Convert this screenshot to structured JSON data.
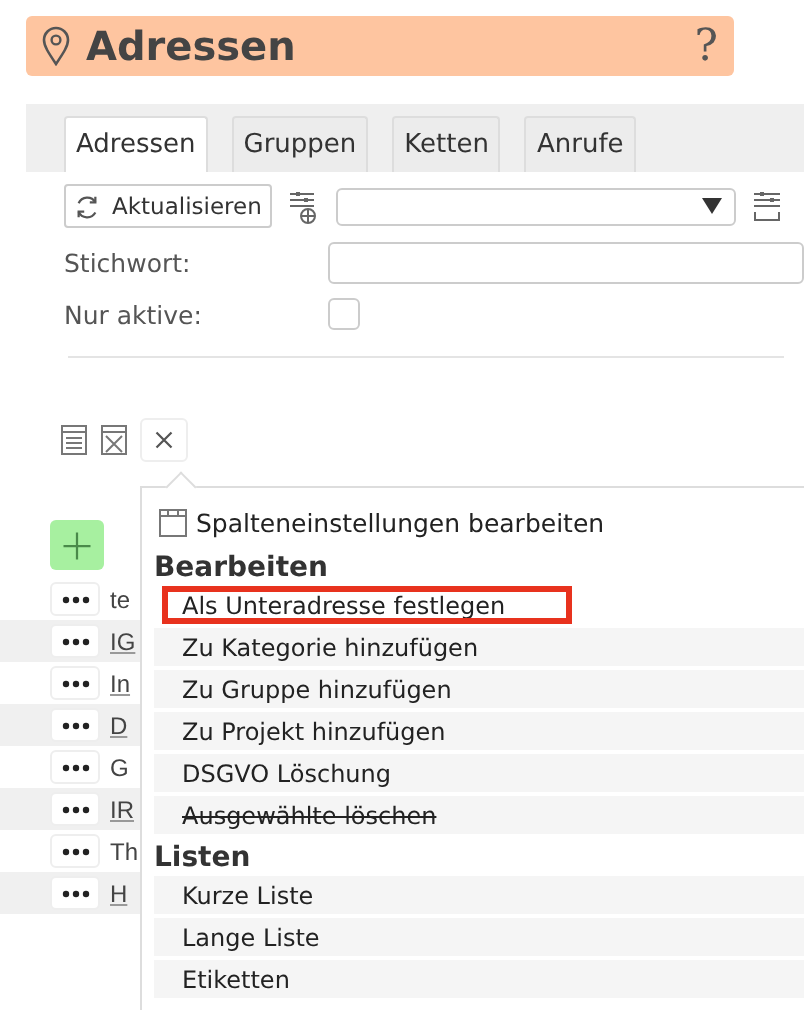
{
  "header": {
    "title": "Adressen",
    "help": "?"
  },
  "tabs": [
    {
      "label": "Adressen",
      "selected": true
    },
    {
      "label": "Gruppen",
      "selected": false
    },
    {
      "label": "Ketten",
      "selected": false
    },
    {
      "label": "Anrufe",
      "selected": false
    }
  ],
  "toolbar": {
    "refresh": "Aktualisieren"
  },
  "filters": [
    {
      "label": "Stichwort:",
      "kind": "text"
    },
    {
      "label": "Nur aktive:",
      "kind": "checkbox",
      "checked": false
    }
  ],
  "rows": [
    {
      "text": "te",
      "link": false
    },
    {
      "text": "IG",
      "link": true
    },
    {
      "text": "In",
      "link": true
    },
    {
      "text": "D",
      "link": true
    },
    {
      "text": "G",
      "link": false
    },
    {
      "text": "IR",
      "link": true
    },
    {
      "text": "Th",
      "link": false
    },
    {
      "text": "H",
      "link": true
    }
  ],
  "menu": [
    {
      "kind": "item",
      "label": "Spalteneinstellungen bearbeiten",
      "icon": true,
      "selected": false,
      "disabled": false
    },
    {
      "kind": "header",
      "label": "Bearbeiten"
    },
    {
      "kind": "item",
      "label": "Als Unteradresse festlegen",
      "icon": false,
      "selected": true,
      "disabled": false
    },
    {
      "kind": "item",
      "label": "Zu Kategorie hinzufügen",
      "icon": false,
      "selected": false,
      "disabled": false
    },
    {
      "kind": "item",
      "label": "Zu Gruppe hinzufügen",
      "icon": false,
      "selected": false,
      "disabled": false
    },
    {
      "kind": "item",
      "label": "Zu Projekt hinzufügen",
      "icon": false,
      "selected": false,
      "disabled": false
    },
    {
      "kind": "item",
      "label": "DSGVO Löschung",
      "icon": false,
      "selected": false,
      "disabled": false
    },
    {
      "kind": "item",
      "label": "Ausgewählte löschen",
      "icon": false,
      "selected": false,
      "disabled": true
    },
    {
      "kind": "header",
      "label": "Listen"
    },
    {
      "kind": "item",
      "label": "Kurze Liste",
      "icon": false,
      "selected": false,
      "disabled": false
    },
    {
      "kind": "item",
      "label": "Lange Liste",
      "icon": false,
      "selected": false,
      "disabled": false
    },
    {
      "kind": "item",
      "label": "Etiketten",
      "icon": false,
      "selected": false,
      "disabled": false
    }
  ]
}
